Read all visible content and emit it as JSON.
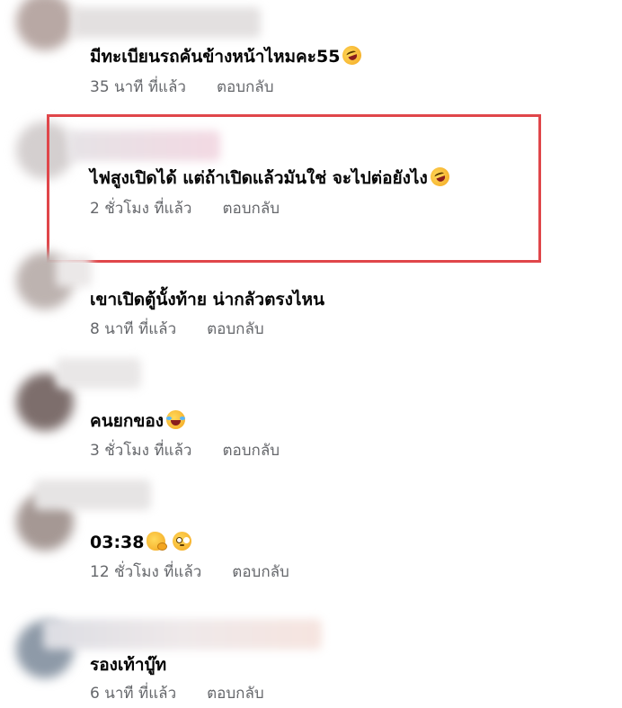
{
  "comments": [
    {
      "text": "มีทะเบียนรถคันข้างหน้าไหมคะ55",
      "emoji": "rolling-on-floor-laughing",
      "time": "35 นาที ที่แล้ว",
      "reply": "ตอบกลับ"
    },
    {
      "text": "ไฟสูงเปิดได้ แต่ถ้าเปิดแล้วมันใช่ จะไปต่อยังไง",
      "emoji": "rolling-on-floor-laughing",
      "time": "2 ชั่วโมง ที่แล้ว",
      "reply": "ตอบกลับ"
    },
    {
      "text": "เขาเปิดตู้นั้งท้าย น่ากลัวตรงไหน",
      "time": "8 นาที ที่แล้ว",
      "reply": "ตอบกลับ"
    },
    {
      "text": "คนยกของ",
      "emoji": "grinning-squinting-face",
      "time": "3 ชั่วโมง ที่แล้ว",
      "reply": "ตอบกลับ"
    },
    {
      "text": "03:38",
      "emoji": "hugging-face flushed-face",
      "time": "12 ชั่วโมง ที่แล้ว",
      "reply": "ตอบกลับ"
    },
    {
      "text": "รองเท้าบู๊ท",
      "time": "6 นาที ที่แล้ว",
      "reply": "ตอบกลับ"
    }
  ],
  "colors": {
    "highlight": "#e0464a",
    "meta": "#65676b",
    "text": "#050505"
  }
}
